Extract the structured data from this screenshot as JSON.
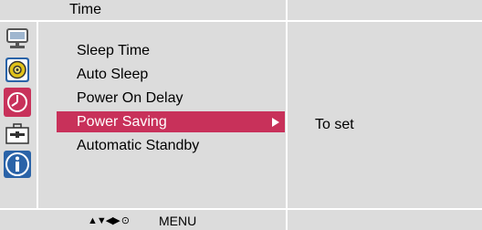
{
  "header": {
    "title": "Time"
  },
  "icons": [
    {
      "name": "picture-icon",
      "selected": false
    },
    {
      "name": "sound-icon",
      "selected": false
    },
    {
      "name": "time-icon",
      "selected": true
    },
    {
      "name": "option-icon",
      "selected": false
    },
    {
      "name": "information-icon",
      "selected": false
    }
  ],
  "menu": {
    "items": [
      {
        "label": "Sleep Time",
        "selected": false
      },
      {
        "label": "Auto Sleep",
        "selected": false
      },
      {
        "label": "Power On Delay",
        "selected": false
      },
      {
        "label": "Power Saving",
        "selected": true
      },
      {
        "label": "Automatic Standby",
        "selected": false
      }
    ]
  },
  "info_panel": {
    "value": "To set"
  },
  "footer": {
    "nav_glyphs": "▲▼◀▶ ⊙",
    "nav_label": "MENU"
  },
  "colors": {
    "panel_bg": "#dcdcdc",
    "selected_bg": "#c8315a",
    "selected_text": "#ffffff",
    "icon_blue": "#2a63a8"
  }
}
